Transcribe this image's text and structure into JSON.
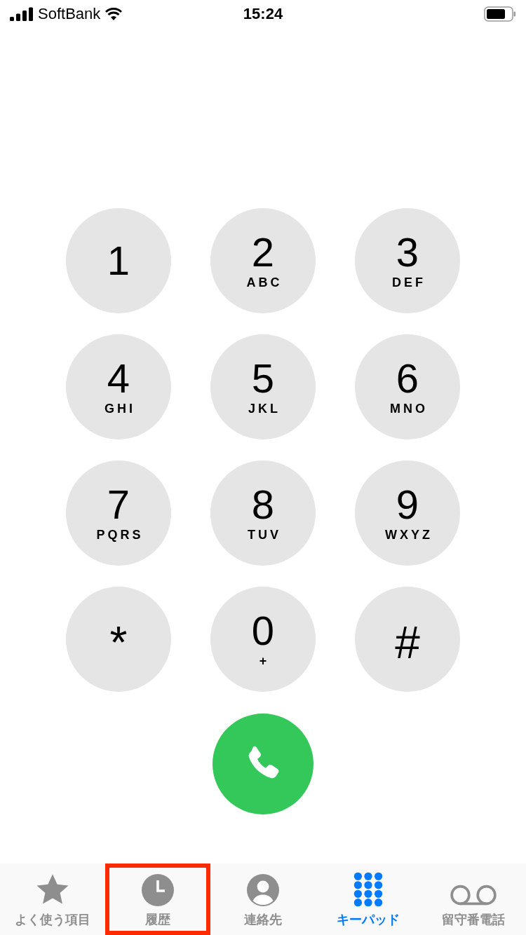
{
  "status_bar": {
    "carrier": "SoftBank",
    "time": "15:24"
  },
  "keypad": [
    {
      "digit": "1"
    },
    {
      "digit": "2",
      "letters": "ABC"
    },
    {
      "digit": "3",
      "letters": "DEF"
    },
    {
      "digit": "4",
      "letters": "GHI"
    },
    {
      "digit": "5",
      "letters": "JKL"
    },
    {
      "digit": "6",
      "letters": "MNO"
    },
    {
      "digit": "7",
      "letters": "PQRS"
    },
    {
      "digit": "8",
      "letters": "TUV"
    },
    {
      "digit": "9",
      "letters": "WXYZ"
    },
    {
      "digit": "*"
    },
    {
      "digit": "0",
      "letters": "+"
    },
    {
      "digit": "#"
    }
  ],
  "tabs": [
    {
      "kind": "star",
      "label": "よく使う項目",
      "selected": false,
      "highlighted": false
    },
    {
      "kind": "clock",
      "label": "履歴",
      "selected": false,
      "highlighted": true
    },
    {
      "kind": "person",
      "label": "連絡先",
      "selected": false,
      "highlighted": false
    },
    {
      "kind": "keypad",
      "label": "キーパッド",
      "selected": true,
      "highlighted": false
    },
    {
      "kind": "voicemail",
      "label": "留守番電話",
      "selected": false,
      "highlighted": false
    }
  ]
}
